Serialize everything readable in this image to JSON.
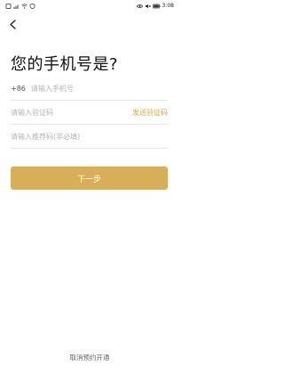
{
  "status_bar": {
    "left_icons": [
      "sim-icon",
      "signal-icon",
      "wifi-icon",
      "shield-icon"
    ],
    "right_icons": [
      "eye-icon",
      "mute-icon",
      "battery-icon"
    ],
    "time": "3:08"
  },
  "header": {
    "back_icon": "chevron-left-icon"
  },
  "title": "您的手机号是?",
  "phone": {
    "country_code": "+86",
    "placeholder": "请输入手机号",
    "value": ""
  },
  "code": {
    "placeholder": "请输入验证码",
    "value": "",
    "send_label": "发送验证码"
  },
  "referral": {
    "placeholder": "请输入推荐码(非必填)",
    "value": ""
  },
  "next_button": {
    "label": "下一步"
  },
  "footer": {
    "cancel_label": "取消预约开通"
  },
  "colors": {
    "accent": "#d8ae59",
    "link": "#d6a94f"
  }
}
